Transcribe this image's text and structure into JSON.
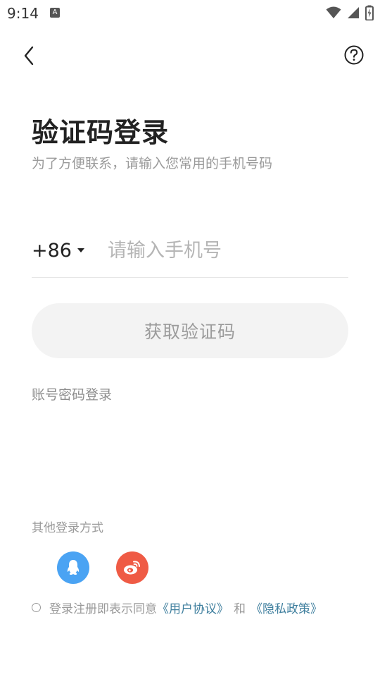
{
  "status_bar": {
    "time": "9:14",
    "notification_icon_letter": "A",
    "icons": [
      "wifi-icon",
      "signal-icon",
      "battery-charging-icon"
    ]
  },
  "nav": {
    "back_icon": "chevron-left-icon",
    "help_icon": "question-circle-icon"
  },
  "header": {
    "title": "验证码登录",
    "subtitle": "为了方便联系，请输入您常用的手机号码"
  },
  "phone": {
    "country_code": "+86",
    "placeholder": "请输入手机号",
    "value": ""
  },
  "actions": {
    "get_code_label": "获取验证码",
    "password_login_label": "账号密码登录"
  },
  "other_login": {
    "label": "其他登录方式",
    "providers": [
      {
        "icon": "qq-icon",
        "color": "#4aa3f3"
      },
      {
        "icon": "weibo-icon",
        "color": "#ef5b45"
      }
    ]
  },
  "agreement": {
    "prefix": "登录注册即表示同意",
    "user_agreement": "《用户协议》",
    "and": "和",
    "privacy_policy": "《隐私政策》",
    "checked": false
  },
  "colors": {
    "link": "#3f7f9e",
    "button_bg": "#f3f3f3",
    "muted_text": "#9a9a9a"
  }
}
